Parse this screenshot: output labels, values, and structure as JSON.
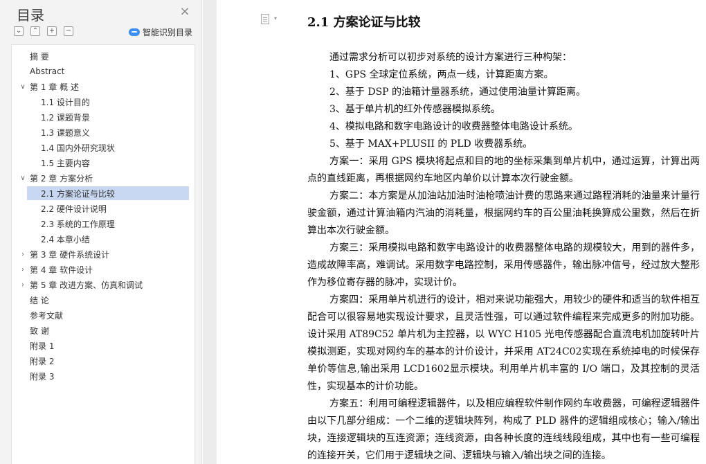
{
  "sidebar": {
    "title": "目录",
    "close_glyph": "×",
    "tool_buttons": [
      {
        "name": "collapse-all-icon",
        "glyph": "⌄"
      },
      {
        "name": "expand-up-icon",
        "glyph": "⌃"
      },
      {
        "name": "add-heading-icon",
        "glyph": "+"
      },
      {
        "name": "remove-heading-icon",
        "glyph": "−"
      }
    ],
    "smart_toc_label": "智能识别目录",
    "smart_toc_icon": "cloud-icon",
    "selected_bg": "#c9d8f2",
    "toc": [
      {
        "label": "摘  要",
        "level": 0,
        "expander": ""
      },
      {
        "label": "Abstract",
        "level": 0,
        "expander": ""
      },
      {
        "label": "第 1 章  概  述",
        "level": 0,
        "expander": "∨"
      },
      {
        "label": "1.1  设计目的",
        "level": 1,
        "expander": ""
      },
      {
        "label": "1.2  课题背景",
        "level": 1,
        "expander": ""
      },
      {
        "label": "1.3  课题意义",
        "level": 1,
        "expander": ""
      },
      {
        "label": "1.4  国内外研究现状",
        "level": 1,
        "expander": ""
      },
      {
        "label": "1.5  主要内容",
        "level": 1,
        "expander": ""
      },
      {
        "label": "第 2 章  方案分析",
        "level": 0,
        "expander": "∨"
      },
      {
        "label": "2.1  方案论证与比较",
        "level": 1,
        "expander": "",
        "selected": true
      },
      {
        "label": "2.2  硬件设计说明",
        "level": 1,
        "expander": ""
      },
      {
        "label": "2.3  系统的工作原理",
        "level": 1,
        "expander": ""
      },
      {
        "label": "2.4  本章小结",
        "level": 1,
        "expander": ""
      },
      {
        "label": "第 3 章  硬件系统设计",
        "level": 0,
        "expander": "›"
      },
      {
        "label": "第 4 章  软件设计",
        "level": 0,
        "expander": "›"
      },
      {
        "label": "第 5 章  改进方案、仿真和调试",
        "level": 0,
        "expander": "›"
      },
      {
        "label": "结  论",
        "level": 0,
        "expander": ""
      },
      {
        "label": "参考文献",
        "level": 0,
        "expander": ""
      },
      {
        "label": "致  谢",
        "level": 0,
        "expander": ""
      },
      {
        "label": "附录 1",
        "level": 0,
        "expander": ""
      },
      {
        "label": "附录 2",
        "level": 0,
        "expander": ""
      },
      {
        "label": "附录 3",
        "level": 0,
        "expander": ""
      }
    ]
  },
  "document": {
    "heading": "2.1  方案论证与比较",
    "paragraphs": [
      {
        "text": "通过需求分析可以初步对系统的设计方案进行三种构架：",
        "indent": true
      },
      {
        "text": "1、GPS 全球定位系统，两点一线，计算距离方案。",
        "indent": true
      },
      {
        "text": "2、基于 DSP 的油箱计量器系统，通过使用油量计算距离。",
        "indent": true
      },
      {
        "text": "3、基于单片机的红外传感器模拟系统。",
        "indent": true
      },
      {
        "text": "4、模拟电路和数字电路设计的收费器整体电路设计系统。",
        "indent": true
      },
      {
        "text": "5、基于 MAX+PLUSII 的 PLD 收费器系统。",
        "indent": true
      },
      {
        "text": "方案一：采用 GPS 模块将起点和目的地的坐标采集到单片机中，通过运算，计算出两点的直线距离，再根据网约车地区内单价以计算本次行驶金额。",
        "indent": true
      },
      {
        "text": "方案二：本方案是从加油站加油时油枪喷油计费的思路来通过路程消耗的油量来计量行驶金额，通过计算油箱内汽油的消耗量，根据网约车的百公里油耗换算成公里数，然后在折算出本次行驶金额。",
        "indent": true
      },
      {
        "text": "方案三：采用模拟电路和数字电路设计的收费器整体电路的规模较大，用到的器件多，造成故障率高，难调试。采用数字电路控制，采用传感器件，输出脉冲信号，经过放大整形作为移位寄存器的脉冲，实现计价。",
        "indent": true
      },
      {
        "text": "方案四：采用单片机进行的设计，相对来说功能强大，用较少的硬件和适当的软件相互配合可以很容易地实现设计要求，且灵活性强，可以通过软件编程来完成更多的附加功能。设计采用 AT89C52 单片机为主控器，以 WYC H105 光电传感器配合直流电机加旋转叶片模拟测距，实现对网约车的基本的计价设计，并采用 AT24C02实现在系统掉电的时候保存单价等信息,输出采用 LCD1602显示模块。利用单片机丰富的 I/O 端口，及其控制的灵活性，实现基本的计价功能。",
        "indent": true
      },
      {
        "text": "方案五：利用可编程逻辑器件，以及相应编程软件制作网约车收费器，可编程逻辑器件由以下几部分组成：一个二维的逻辑块阵列，构成了 PLD 器件的逻辑组成核心；输入/输出块，连接逻辑块的互连资源；连线资源，由各种长度的连线线段组成，其中也有一些可编程的连接开关，它们用于逻辑块之间、逻辑块与输入/输出块之间的连接。",
        "indent": true
      }
    ]
  }
}
